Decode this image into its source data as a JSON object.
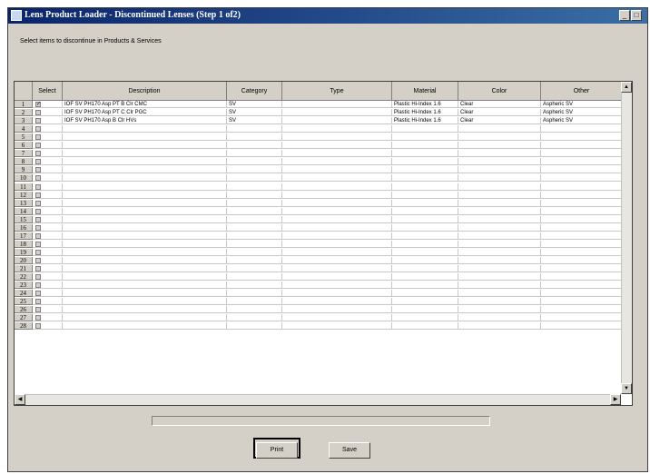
{
  "window": {
    "title": "Lens Product Loader - Discontinued Lenses (Step 1 of2)",
    "minimize_glyph": "_",
    "maximize_glyph": "□"
  },
  "instruction": "Select items to discontinue in Products & Services",
  "table": {
    "columns": [
      "Select",
      "Description",
      "Category",
      "Type",
      "Material",
      "Color",
      "Other"
    ],
    "rows": [
      {
        "n": "1",
        "checked": true,
        "description": "IOF SV PH170 Asp PT B Clr CMC",
        "category": "SV",
        "type": "",
        "material": "Plastic Hi-Index 1.6",
        "color": "Clear",
        "other": "Aspheric SV"
      },
      {
        "n": "2",
        "checked": false,
        "description": "IOF SV PH170 Asp PT C Clr PGC",
        "category": "SV",
        "type": "",
        "material": "Plastic Hi-Index 1.6",
        "color": "Clear",
        "other": "Aspheric SV"
      },
      {
        "n": "3",
        "checked": false,
        "description": "IOF SV PH170 Asp B Clr HVs",
        "category": "SV",
        "type": "",
        "material": "Plastic Hi-Index 1.6",
        "color": "Clear",
        "other": "Aspheric SV"
      },
      {
        "n": "4"
      },
      {
        "n": "5"
      },
      {
        "n": "6"
      },
      {
        "n": "7"
      },
      {
        "n": "8"
      },
      {
        "n": "9"
      },
      {
        "n": "10"
      },
      {
        "n": "11"
      },
      {
        "n": "12"
      },
      {
        "n": "13"
      },
      {
        "n": "14"
      },
      {
        "n": "15"
      },
      {
        "n": "16"
      },
      {
        "n": "17"
      },
      {
        "n": "18"
      },
      {
        "n": "19"
      },
      {
        "n": "20"
      },
      {
        "n": "21"
      },
      {
        "n": "22"
      },
      {
        "n": "23"
      },
      {
        "n": "24"
      },
      {
        "n": "25"
      },
      {
        "n": "26"
      },
      {
        "n": "27"
      },
      {
        "n": "28"
      }
    ]
  },
  "scroll": {
    "up": "▲",
    "down": "▼",
    "left": "◀",
    "right": "▶"
  },
  "check_glyph": "✓",
  "buttons": {
    "print": "Print",
    "save": "Save"
  }
}
